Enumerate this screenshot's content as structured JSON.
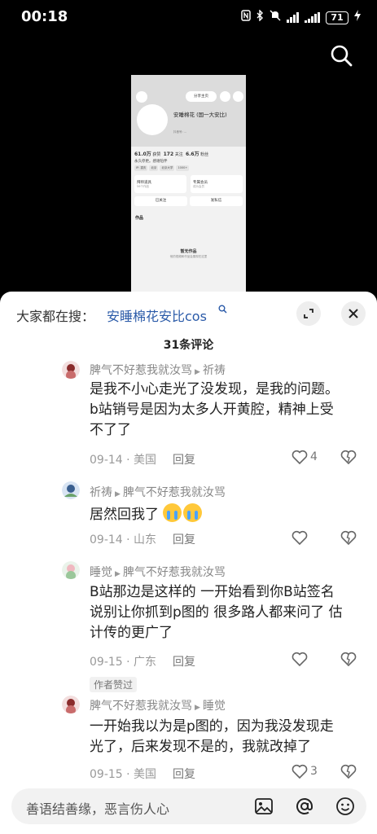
{
  "status_bar": {
    "time": "00:18",
    "battery": "71"
  },
  "preview": {
    "share_label": "分享主页",
    "name": "安睡棉花 (国一大安比)",
    "uid": "抖音号: ...",
    "stats": [
      {
        "value": "61.0万",
        "label": "获赞"
      },
      {
        "value": "172",
        "label": "关注"
      },
      {
        "value": "6.6万",
        "label": "粉丝"
      }
    ],
    "bio": "永久停更。感谢陪伴",
    "tags": [
      "IP: 重庆",
      "北京",
      "北京大学",
      "1000+"
    ],
    "cards": [
      {
        "title": "拜师道具",
        "sub": "56个作品"
      },
      {
        "title": "专属会员",
        "sub": "成为会员"
      }
    ],
    "actions": [
      "已关注",
      "发私信"
    ],
    "works_label": "作品",
    "empty_title": "暂无作品",
    "empty_sub": "他的视频和作品会展现在这里"
  },
  "sheet": {
    "people_search_label": "大家都在搜：",
    "people_search_term": "安睡棉花安比cos",
    "comment_count": "31条评论"
  },
  "comments": [
    {
      "from": "脾气不好惹我就汝骂",
      "to": "祈祷",
      "lines": [
        "是我不小心走光了没发现，是我的问题。",
        "b站销号是因为太多人开黄腔，精神上受",
        "不了了"
      ],
      "date": "09-14",
      "location": "美国",
      "reply": "回复",
      "likes": "4"
    },
    {
      "from": "祈祷",
      "to": "脾气不好惹我就汝骂",
      "lines": [
        "居然回我了"
      ],
      "date": "09-14",
      "location": "山东",
      "reply": "回复",
      "likes": ""
    },
    {
      "from": "睡觉",
      "to": "脾气不好惹我就汝骂",
      "lines": [
        "B站那边是这样的 一开始看到你B站签名",
        "说别让你抓到p图的 很多路人都来问了 估",
        "计传的更广了"
      ],
      "date": "09-15",
      "location": "广东",
      "reply": "回复",
      "likes": "",
      "badge": "作者赞过"
    },
    {
      "from": "脾气不好惹我就汝骂",
      "to": "睡觉",
      "lines": [
        "一开始我以为是p图的，因为我没发现走",
        "光了，后来发现不是的，我就改掉了"
      ],
      "date": "09-15",
      "location": "美国",
      "reply": "回复",
      "likes": "3"
    }
  ],
  "input": {
    "placeholder": "善语结善缘，恶言伤人心"
  }
}
